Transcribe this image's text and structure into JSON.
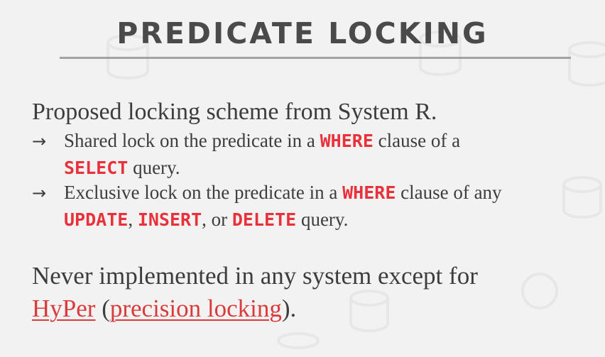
{
  "slide": {
    "title": "PREDICATE LOCKING",
    "intro": "Proposed locking scheme from System R.",
    "bullet1": {
      "arrow": "→",
      "pre": "Shared lock on the predicate in a ",
      "kw1": "WHERE",
      "mid": " clause of a",
      "kw2": "SELECT",
      "post": " query."
    },
    "bullet2": {
      "arrow": "→",
      "pre": "Exclusive lock on the predicate in a ",
      "kw1": "WHERE",
      "mid": " clause of any",
      "kw2": "UPDATE",
      "sep1": ", ",
      "kw3": "INSERT",
      "sep2": ", or ",
      "kw4": "DELETE",
      "post": " query."
    },
    "closing": {
      "pre": "Never implemented in any system except for",
      "link1": "HyPer",
      "open": " (",
      "link2": "precision locking",
      "close": ")."
    }
  },
  "colors": {
    "keyword": "#e8313b",
    "link": "#d93a3a",
    "background": "#f2f2f2"
  }
}
